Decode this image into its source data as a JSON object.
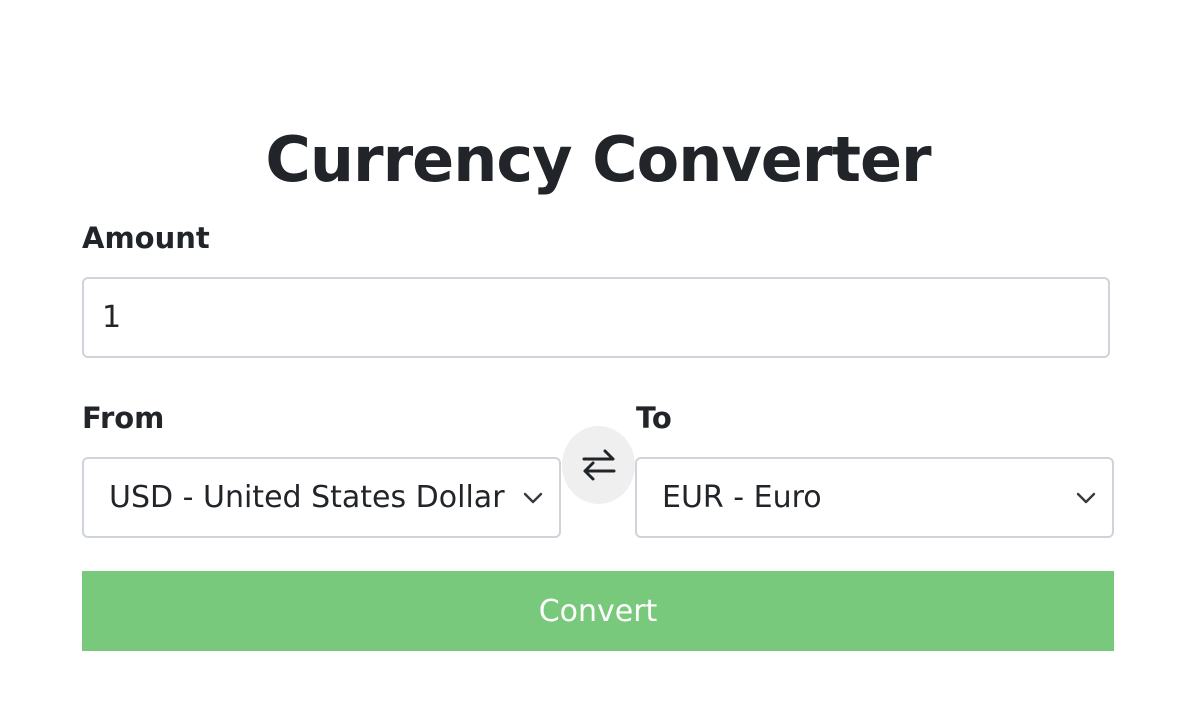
{
  "header": {
    "title": "Currency Converter"
  },
  "amount": {
    "label": "Amount",
    "value": "1"
  },
  "from": {
    "label": "From",
    "selected": "USD - United States Dollar"
  },
  "to": {
    "label": "To",
    "selected": "EUR - Euro"
  },
  "swap": {
    "icon": "swap-arrows-icon"
  },
  "actions": {
    "convert_label": "Convert"
  },
  "colors": {
    "convert_button": "#78c97b",
    "swap_button": "#efefef",
    "text": "#212529",
    "border": "#ced4da"
  }
}
